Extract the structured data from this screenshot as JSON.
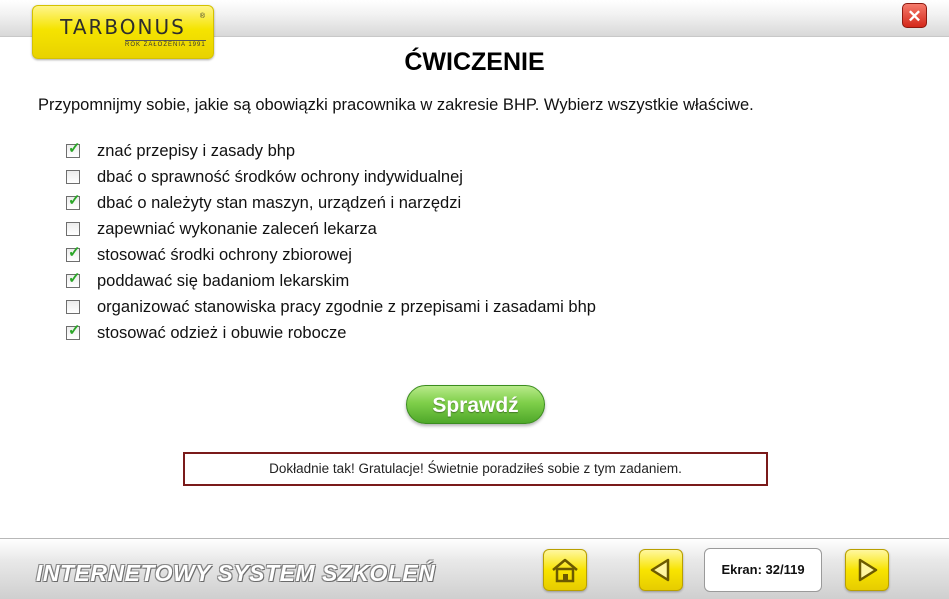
{
  "header": {
    "logo": {
      "name": "TARBONUS",
      "registered": "®",
      "tagline": "ROK ZAŁOŻENIA 1991"
    },
    "close_icon": "close-icon",
    "close_glyph": "✕"
  },
  "exercise": {
    "title": "ĆWICZENIE",
    "instruction": "Przypomnijmy sobie, jakie są obowiązki pracownika w zakresie BHP. Wybierz wszystkie właściwe.",
    "options": [
      {
        "label": "znać przepisy i zasady bhp",
        "checked": true
      },
      {
        "label": "dbać o sprawność środków ochrony indywidualnej",
        "checked": false
      },
      {
        "label": "dbać o należyty stan maszyn, urządzeń i narzędzi",
        "checked": true
      },
      {
        "label": "zapewniać wykonanie zaleceń lekarza",
        "checked": false
      },
      {
        "label": "stosować środki ochrony zbiorowej",
        "checked": true
      },
      {
        "label": "poddawać się badaniom lekarskim",
        "checked": true
      },
      {
        "label": "organizować stanowiska pracy zgodnie z przepisami i zasadami bhp",
        "checked": false
      },
      {
        "label": "stosować odzież i obuwie robocze",
        "checked": true
      }
    ],
    "check_glyph": "✓",
    "check_button_label": "Sprawdź",
    "feedback": "Dokładnie tak! Gratulacje! Świetnie poradziłeś sobie z tym zadaniem."
  },
  "footer": {
    "system_title": "INTERNETOWY SYSTEM SZKOLEŃ",
    "screen_counter": "Ekran: 32/119",
    "icons": {
      "home": "home-icon",
      "prev": "arrow-left-icon",
      "next": "arrow-right-icon"
    }
  },
  "colors": {
    "logo_yellow": "#f5e400",
    "close_red": "#d4281a",
    "check_green": "#2ba628",
    "button_green": "#7fcf4a",
    "feedback_border": "#7a1a1a",
    "nav_yellow": "#f8e400"
  }
}
